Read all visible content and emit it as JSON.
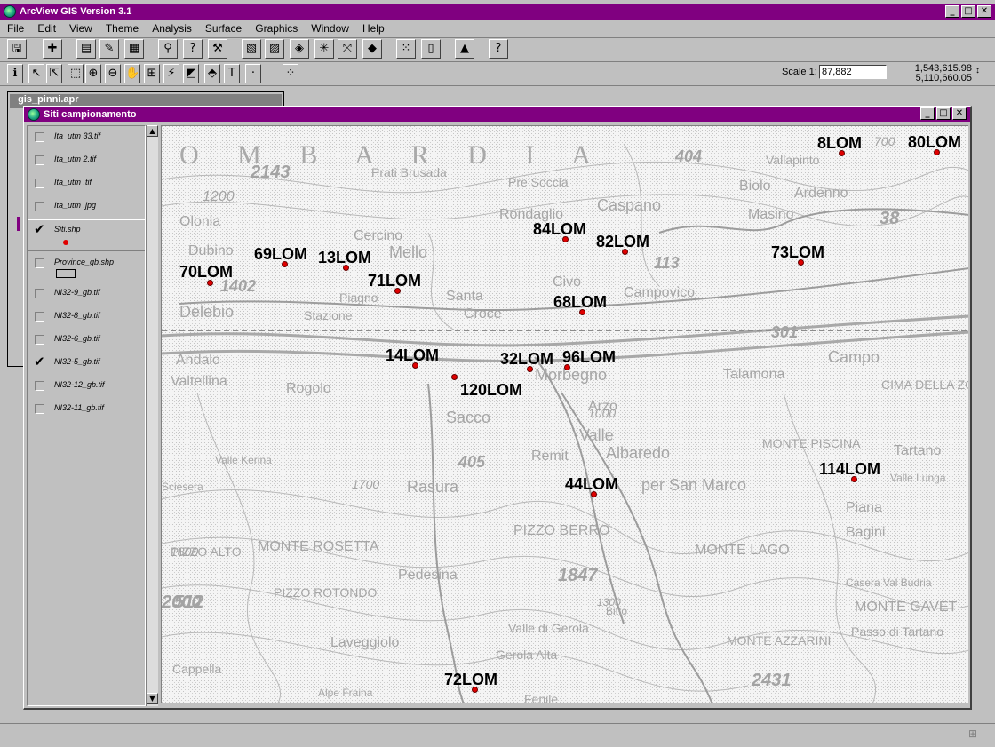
{
  "app": {
    "title": "ArcView GIS Version 3.1",
    "accent": "#800080"
  },
  "menu": [
    "File",
    "Edit",
    "View",
    "Theme",
    "Analysis",
    "Surface",
    "Graphics",
    "Window",
    "Help"
  ],
  "toolbar": {
    "buttons": [
      "save-icon",
      "add-theme-icon",
      "theme-properties-icon",
      "edit-legend-icon",
      "open-table-icon",
      "find-icon",
      "query-icon",
      "hammer-icon",
      "zoom-to-themes-icon",
      "zoom-to-selected-icon",
      "select-feature-icon",
      "zoom-in-fixed-icon",
      "zoom-out-fixed-icon",
      "previous-extent-icon",
      "clear-selection-icon",
      "layout-icon",
      "north-arrow-icon",
      "help-icon"
    ],
    "tools": [
      "identify-icon",
      "pointer-icon",
      "vertex-edit-icon",
      "select-icon",
      "zoom-in-icon",
      "zoom-out-icon",
      "pan-icon",
      "measure-icon",
      "hotlink-icon",
      "area-icon",
      "label-icon",
      "text-icon",
      "draw-point-icon",
      "snap-icon"
    ],
    "scale_label": "Scale 1:",
    "scale_value": "87,882",
    "coord_x": "1,543,615.98",
    "coord_y": "5,110,660.05"
  },
  "project_window": {
    "title": "gis_pinni.apr"
  },
  "view": {
    "title": "Siti campionamento",
    "themes": [
      {
        "name": "Ita_utm 33.tif",
        "checked": false
      },
      {
        "name": "Ita_utm 2.tif",
        "checked": false
      },
      {
        "name": "Ita_utm .tif",
        "checked": false
      },
      {
        "name": "Ita_utm .jpg",
        "checked": false
      },
      {
        "name": "Siti.shp",
        "checked": true,
        "legend": "point"
      },
      {
        "name": "Province_gb.shp",
        "checked": false,
        "legend": "polygon"
      },
      {
        "name": "NI32-9_gb.tif",
        "checked": false
      },
      {
        "name": "NI32-8_gb.tif",
        "checked": false
      },
      {
        "name": "NI32-6_gb.tif",
        "checked": false
      },
      {
        "name": "NI32-5_gb.tif",
        "checked": true
      },
      {
        "name": "NI32-12_gb.tif",
        "checked": false
      },
      {
        "name": "NI32-11_gb.tif",
        "checked": false
      }
    ],
    "point_color": "#e00000"
  },
  "map": {
    "place_names": [
      "O M B A R D I A",
      "Prati Brusada",
      "Pre Soccia",
      "Caspano",
      "Vallapinto",
      "Biolo",
      "Ardenno",
      "Masino",
      "Rondaglio",
      "Cercino",
      "Olonia",
      "Dubino",
      "Mello",
      "Civo",
      "Delebio",
      "Stazione",
      "Piagno",
      "Santa",
      "Croce",
      "Campovico",
      "Talamona",
      "Campo",
      "CIMA DELLA ZOCCA",
      "Valtellina",
      "Sacco",
      "Rogolo",
      "Andalo",
      "Morbegno",
      "Arzo",
      "Valle",
      "Albaredo",
      "Remit",
      "per San Marco",
      "Rasura",
      "MONTE PISCINA",
      "Tartano",
      "Piana",
      "Bagini",
      "MONTE LAGO",
      "Casera Val Budria",
      "MONTE GAVET",
      "MONTE ROSETTA",
      "PIZZO BERRO",
      "PIZZO ALTO",
      "PIZZO ROTONDO",
      "Pedesina",
      "Gerola Alta",
      "Laveggiolo",
      "Cappella",
      "Alpe Fraina",
      "MONTE AZZARINI",
      "Passo di Tartano",
      "Fenile",
      "Bitto",
      "Valle di Gerola",
      "Valle Lunga",
      "Valle Kerina",
      "Sciesera"
    ],
    "numbers": [
      "2143",
      "1200",
      "404",
      "700",
      "38",
      "1402",
      "113",
      "301",
      "405",
      "1700",
      "1000",
      "1800",
      "2000",
      "512",
      "1847",
      "1300",
      "2431"
    ],
    "sites": [
      "8LOM",
      "80LOM",
      "84LOM",
      "82LOM",
      "73LOM",
      "69LOM",
      "13LOM",
      "70LOM",
      "71LOM",
      "68LOM",
      "14LOM",
      "32LOM",
      "96LOM",
      "120LOM",
      "114LOM",
      "44LOM",
      "72LOM"
    ]
  }
}
